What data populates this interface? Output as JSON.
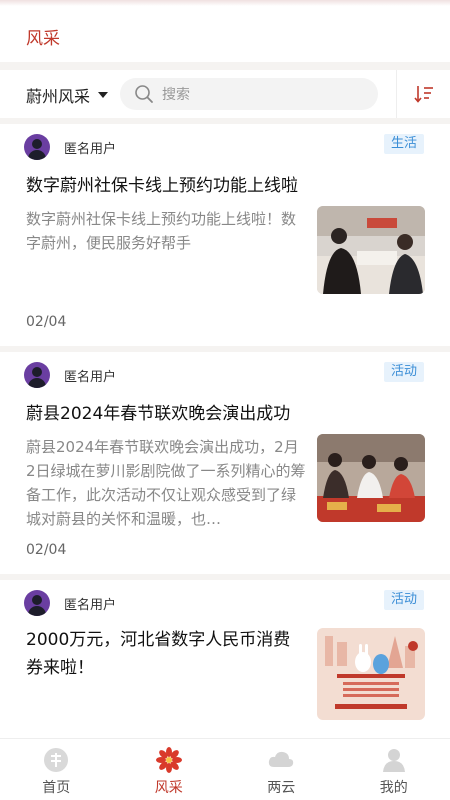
{
  "header": {
    "title": "风采"
  },
  "filter": {
    "region": "蔚州风采",
    "search_placeholder": "搜索"
  },
  "posts": [
    {
      "user": "匿名用户",
      "tag": "生活",
      "title": "数字蔚州社保卡线上预约功能上线啦",
      "summary": "数字蔚州社保卡线上预约功能上线啦！数字蔚州，便民服务好帮手",
      "date": "02/04"
    },
    {
      "user": "匿名用户",
      "tag": "活动",
      "title": "蔚县2024年春节联欢晚会演出成功",
      "summary": "蔚县2024年春节联欢晚会演出成功，2月2日绿城在萝川影剧院做了一系列精心的筹备工作，此次活动不仅让观众感受到了绿城对蔚县的关怀和温暖，也…",
      "date": "02/04"
    },
    {
      "user": "匿名用户",
      "tag": "活动",
      "title": "2000万元，河北省数字人民币消费券来啦！"
    }
  ],
  "tabbar": {
    "items": [
      {
        "label": "首页",
        "icon": "home-icon"
      },
      {
        "label": "风采",
        "icon": "flower-icon",
        "active": true
      },
      {
        "label": "两云",
        "icon": "cloud-icon"
      },
      {
        "label": "我的",
        "icon": "user-icon"
      }
    ]
  },
  "colors": {
    "accent": "#c0392b",
    "tag_text": "#3b8ed6",
    "tag_bg": "#e7f2fc"
  }
}
